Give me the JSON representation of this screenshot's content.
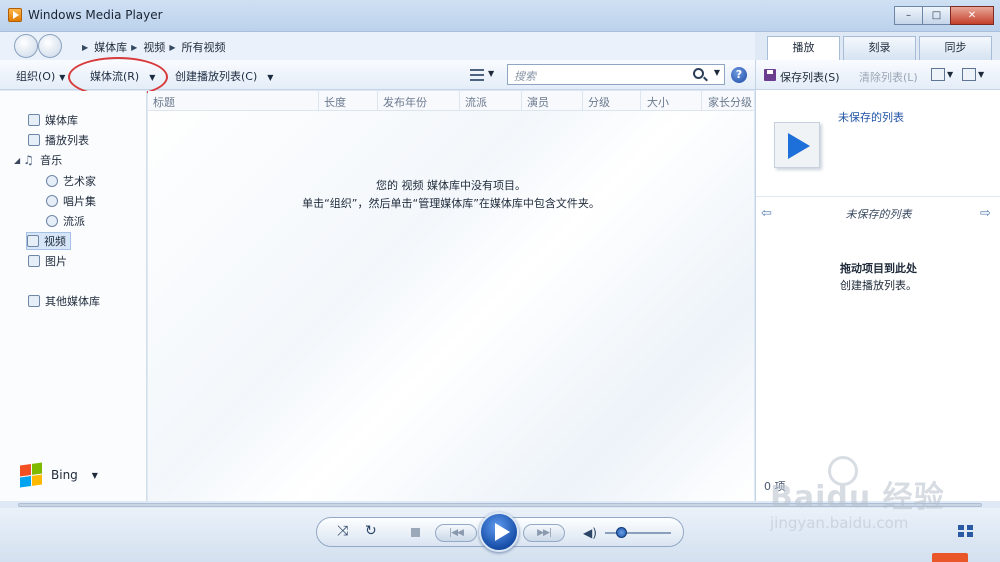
{
  "window": {
    "title": "Windows Media Player",
    "min": "–",
    "max": "□",
    "close": "✕"
  },
  "breadcrumb": [
    "媒体库",
    "视频",
    "所有视频"
  ],
  "tabs": [
    {
      "label": "播放",
      "active": true
    },
    {
      "label": "刻录",
      "active": false
    },
    {
      "label": "同步",
      "active": false
    }
  ],
  "toolbar": {
    "organize": "组织(O)",
    "stream": "媒体流(R)",
    "create_playlist": "创建播放列表(C)",
    "search_placeholder": "搜索"
  },
  "sidebar": {
    "library": "媒体库",
    "playlists": "播放列表",
    "music": "音乐",
    "artist": "艺术家",
    "album": "唱片集",
    "genre": "流派",
    "video": "视频",
    "pictures": "图片",
    "other_libraries": "其他媒体库",
    "bing": "Bing"
  },
  "columns": [
    "标题",
    "长度",
    "发布年份",
    "流派",
    "演员",
    "分级",
    "大小",
    "家长分级"
  ],
  "empty_message": {
    "line1": "您的 视频 媒体库中没有项目。",
    "line2": "单击“组织”，然后单击“管理媒体库”在媒体库中包含文件夹。"
  },
  "right_pane": {
    "save_list": "保存列表(S)",
    "clear_list": "清除列表(L)",
    "unsaved_link": "未保存的列表",
    "unsaved_title": "未保存的列表",
    "drop_heading": "拖动项目到此处",
    "drop_sub": "创建播放列表。",
    "count": "0 项"
  },
  "player": {
    "volume": 0.1
  },
  "watermark": {
    "brand": "Baidu 经验",
    "url": "jingyan.baidu.com"
  },
  "colors": {
    "accent": "#1d6fd9",
    "highlight_ring": "#d8393a"
  }
}
